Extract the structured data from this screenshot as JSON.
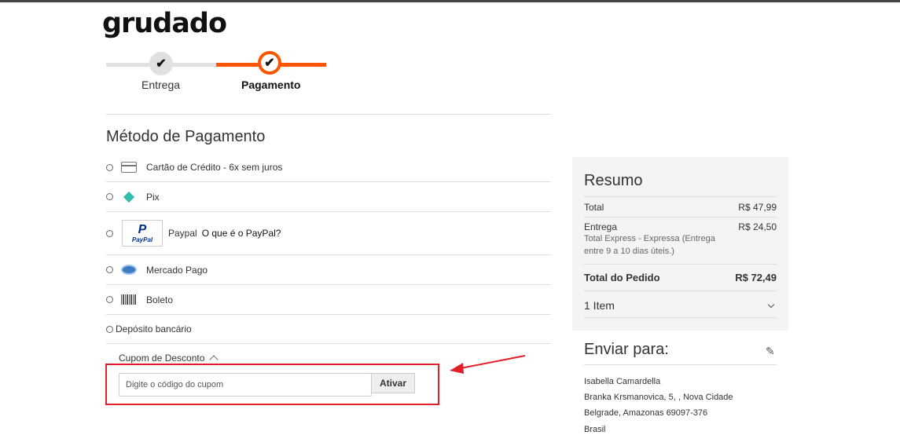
{
  "brand": {
    "logo_text": "grudado"
  },
  "progress": {
    "steps": [
      {
        "label": "Entrega",
        "status": "done"
      },
      {
        "label": "Pagamento",
        "status": "active"
      }
    ],
    "check_glyph": "✔",
    "colors": {
      "active": "#ff5501",
      "inactive": "#e0e0e0"
    }
  },
  "payment": {
    "title": "Método de Pagamento",
    "options": [
      {
        "label": "Cartão de Crédito - 6x sem juros",
        "icon": "credit-card-icon"
      },
      {
        "label": "Pix",
        "icon": "pix-icon"
      },
      {
        "label": "Paypal",
        "link": "O que é o PayPal?",
        "icon": "paypal-logo",
        "logo_text": "PayPal"
      },
      {
        "label": "Mercado Pago",
        "icon": "mercado-pago-icon"
      },
      {
        "label": "Boleto",
        "icon": "barcode-icon"
      },
      {
        "label": "Depósito bancário"
      }
    ]
  },
  "coupon": {
    "heading": "Cupom de Desconto",
    "placeholder": "Digite o código do cupom",
    "button": "Ativar",
    "highlight_color": "#e3202a"
  },
  "summary": {
    "title": "Resumo",
    "total_label": "Total",
    "total_value": "R$ 47,99",
    "shipping_label": "Entrega",
    "shipping_value": "R$ 24,50",
    "shipping_desc": "Total Express - Expressa (Entrega entre 9 a 10 dias úteis.)",
    "order_total_label": "Total do Pedido",
    "order_total_value": "R$ 72,49",
    "items_label": "1 Item"
  },
  "shipping": {
    "title": "Enviar para:",
    "lines": [
      "Isabella Camardella",
      "Branka Krsmanovica, 5, , Nova Cidade",
      "Belgrade, Amazonas 69097-376",
      "Brasil"
    ]
  }
}
